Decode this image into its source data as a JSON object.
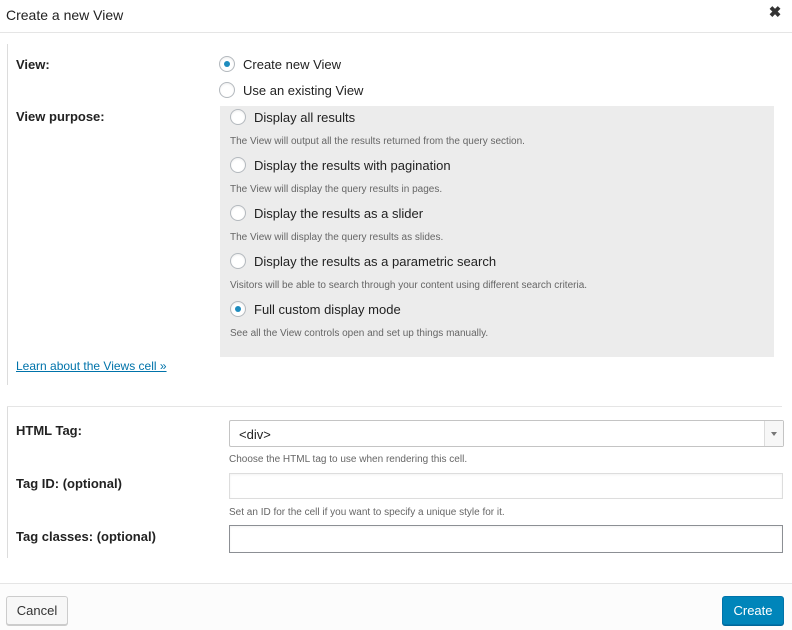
{
  "dialog": {
    "title": "Create a new View",
    "close_symbol": "✖"
  },
  "view": {
    "label": "View:",
    "options": [
      {
        "label": "Create new View",
        "checked": true
      },
      {
        "label": "Use an existing View",
        "checked": false
      }
    ]
  },
  "purpose": {
    "label": "View purpose:",
    "options": [
      {
        "label": "Display all results",
        "description": "The View will output all the results returned from the query section.",
        "checked": false
      },
      {
        "label": "Display the results with pagination",
        "description": "The View will display the query results in pages.",
        "checked": false
      },
      {
        "label": "Display the results as a slider",
        "description": "The View will display the query results as slides.",
        "checked": false
      },
      {
        "label": "Display the results as a parametric search",
        "description": "Visitors will be able to search through your content using different search criteria.",
        "checked": false
      },
      {
        "label": "Full custom display mode",
        "description": "See all the View controls open and set up things manually.",
        "checked": true
      }
    ]
  },
  "learn_link": "Learn about the Views cell »",
  "html_tag": {
    "label": "HTML Tag:",
    "value": "<div>",
    "help": "Choose the HTML tag to use when rendering this cell."
  },
  "tag_id": {
    "label": "Tag ID: (optional)",
    "value": "",
    "help": "Set an ID for the cell if you want to specify a unique style for it."
  },
  "tag_classes": {
    "label": "Tag classes: (optional)",
    "value": ""
  },
  "footer": {
    "cancel_label": "Cancel",
    "create_label": "Create"
  },
  "colors": {
    "accent": "#0085ba",
    "radio_dot": "#1e8cbe",
    "link": "#0073aa",
    "purpose_background": "#ececec"
  }
}
